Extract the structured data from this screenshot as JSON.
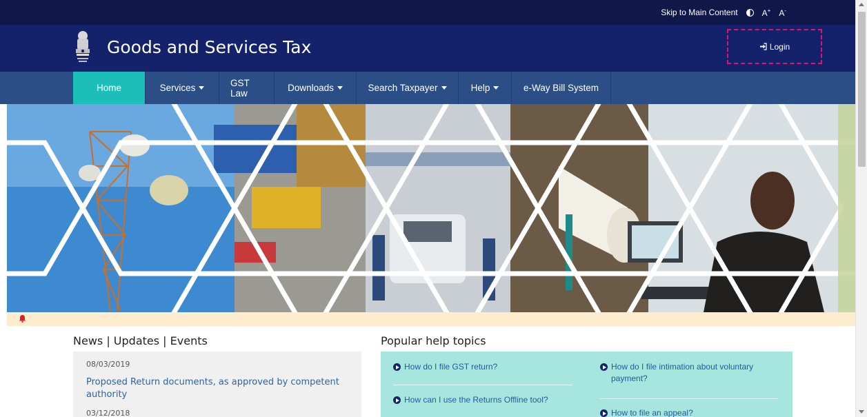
{
  "topbar": {
    "skip_link": "Skip to Main Content",
    "font_increase": "A",
    "font_increase_sup": "+",
    "font_decrease": "A",
    "font_decrease_sup": "-"
  },
  "header": {
    "title": "Goods and Services Tax",
    "login_label": "Login",
    "login_icon": "sign-in-icon",
    "emblem_icon": "national-emblem-icon"
  },
  "nav": {
    "items": [
      {
        "label": "Home",
        "dropdown": false,
        "active": true
      },
      {
        "label": "Services",
        "dropdown": true,
        "active": false
      },
      {
        "label": "GST Law",
        "dropdown": false,
        "active": false
      },
      {
        "label": "Downloads",
        "dropdown": true,
        "active": false
      },
      {
        "label": "Search Taxpayer",
        "dropdown": true,
        "active": false
      },
      {
        "label": "Help",
        "dropdown": true,
        "active": false
      },
      {
        "label": "e-Way Bill System",
        "dropdown": false,
        "active": false
      }
    ]
  },
  "hero": {
    "panels": [
      "telecom-tower",
      "shipping-port",
      "vehicle-assembly",
      "paper-mill",
      "office-worker"
    ]
  },
  "alert_icon": "bell-icon",
  "news": {
    "title": "News | Updates | Events",
    "items": [
      {
        "date": "08/03/2019",
        "text": "Proposed Return documents, as approved by competent authority"
      },
      {
        "date": "03/12/2018",
        "text": ""
      }
    ]
  },
  "help_topics": {
    "title": "Popular help topics",
    "left": [
      "How do I file GST return?",
      "How can I use the Returns Offline tool?"
    ],
    "right": [
      "How do I file intimation about voluntary payment?",
      "How to file an appeal?"
    ]
  },
  "colors": {
    "topbar": "#0f1848",
    "header": "#13226b",
    "nav": "#2c4e86",
    "nav_active": "#1bbfb7",
    "login_border": "#e0146b",
    "alert_strip": "#fdeccd",
    "help_box": "#a6e6df",
    "link": "#2a64a8"
  }
}
